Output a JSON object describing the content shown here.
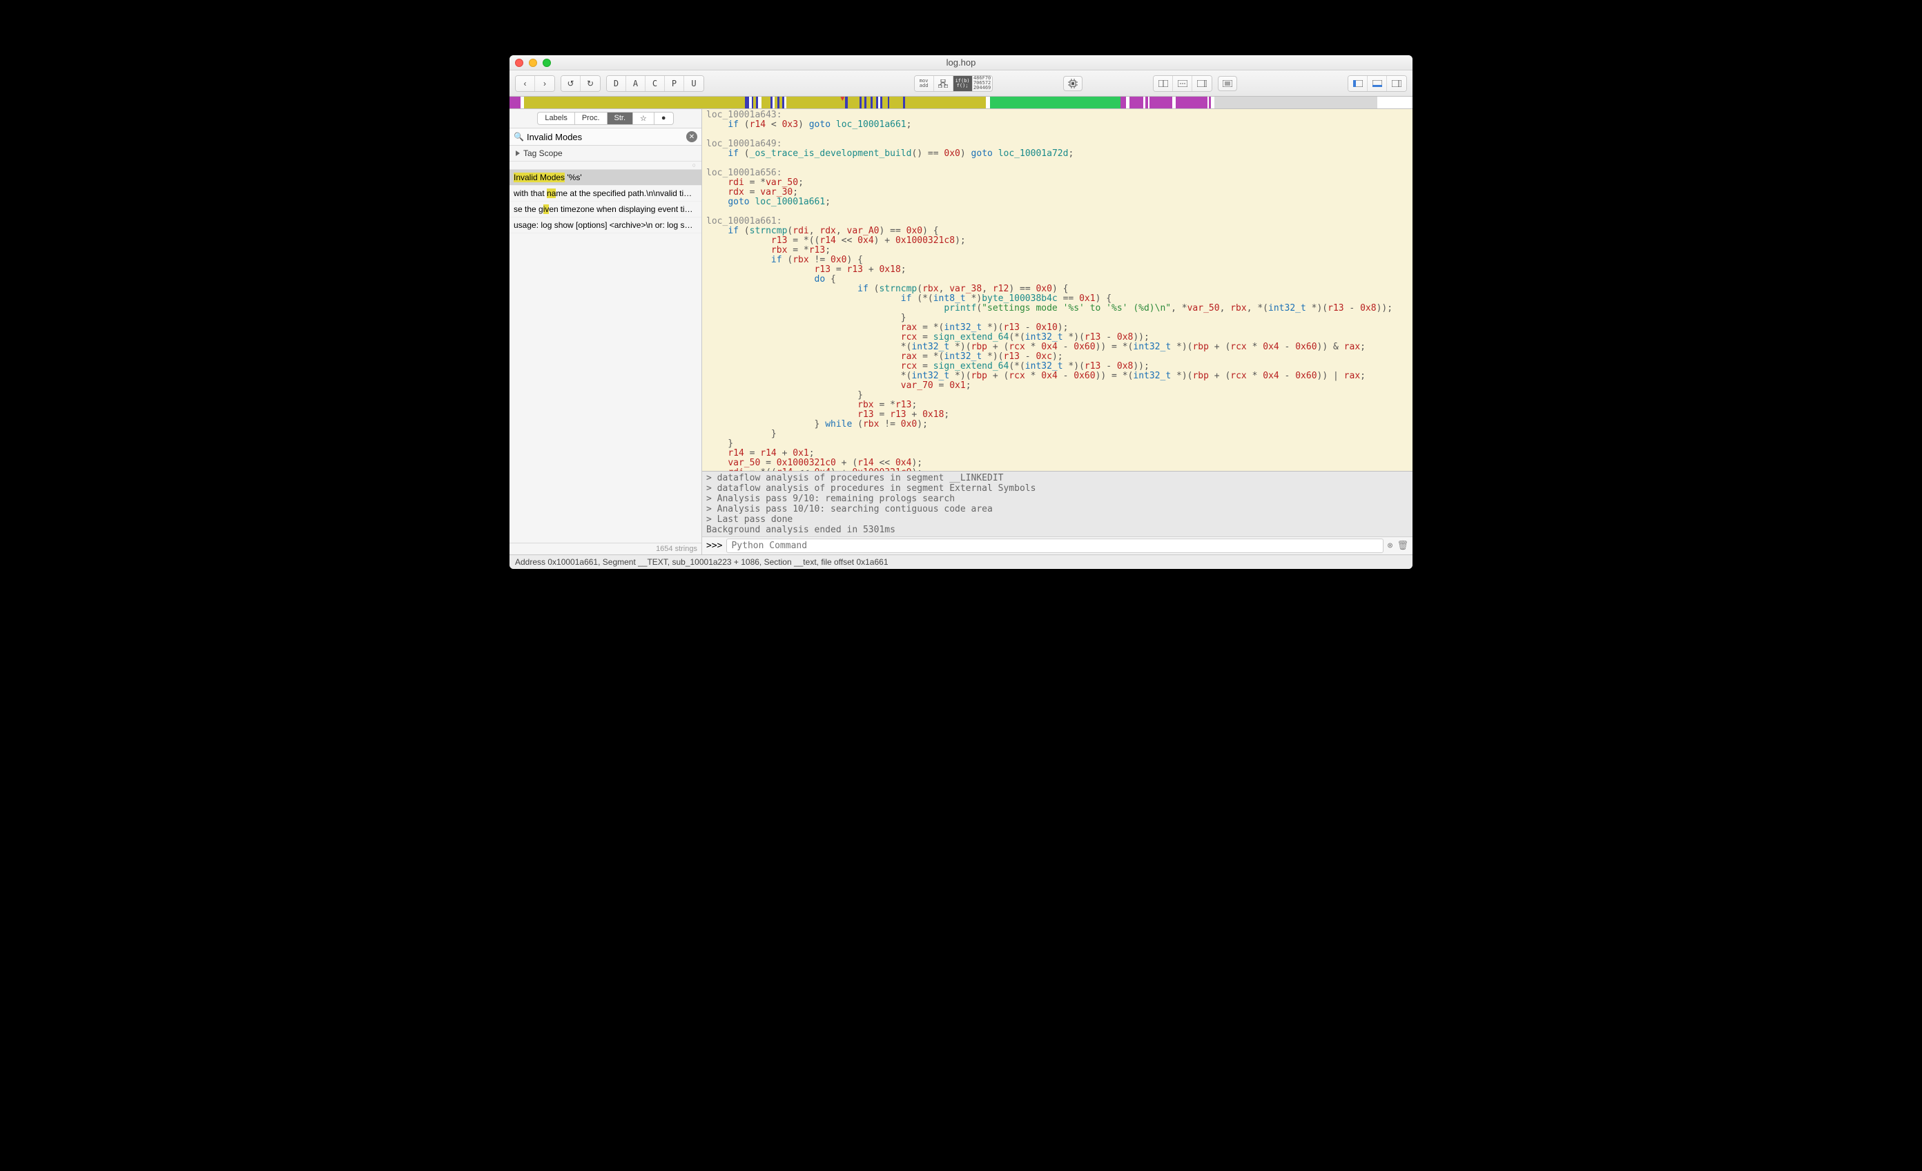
{
  "window": {
    "title": "log.hop"
  },
  "toolbar": {
    "nav_back": "‹",
    "nav_fwd": "›",
    "undo": "↺",
    "redo": "↻",
    "letters": [
      "D",
      "A",
      "C",
      "P",
      "U"
    ],
    "mode_mov": "mov",
    "mode_add": "add",
    "mode_if": "if(b)",
    "mode_f": "f();",
    "mode_num1": "486F70",
    "mode_num2": "706572",
    "mode_num3": "204469"
  },
  "nav": {
    "segments": [
      {
        "w": 1.2,
        "c": "#b541b5"
      },
      {
        "w": 0.4,
        "c": "#ffffff"
      },
      {
        "w": 24.5,
        "c": "#c9c12e"
      },
      {
        "w": 0.4,
        "c": "#3a3ab5"
      },
      {
        "w": 0.3,
        "c": "#ffffff"
      },
      {
        "w": 0.2,
        "c": "#3a3ab5"
      },
      {
        "w": 0.3,
        "c": "#c9c12e"
      },
      {
        "w": 0.2,
        "c": "#3a3ab5"
      },
      {
        "w": 0.4,
        "c": "#ffffff"
      },
      {
        "w": 1.0,
        "c": "#c9c12e"
      },
      {
        "w": 0.2,
        "c": "#3a3ab5"
      },
      {
        "w": 0.3,
        "c": "#ffffff"
      },
      {
        "w": 0.3,
        "c": "#c9c12e"
      },
      {
        "w": 0.2,
        "c": "#3a3ab5"
      },
      {
        "w": 0.3,
        "c": "#c9c12e"
      },
      {
        "w": 0.2,
        "c": "#3a3ab5"
      },
      {
        "w": 0.3,
        "c": "#ffffff"
      },
      {
        "w": 6.5,
        "c": "#c9c12e"
      },
      {
        "w": 0.3,
        "c": "#3a3ab5"
      },
      {
        "w": 1.3,
        "c": "#c9c12e"
      },
      {
        "w": 0.2,
        "c": "#3a3ab5"
      },
      {
        "w": 0.3,
        "c": "#c9c12e"
      },
      {
        "w": 0.2,
        "c": "#3a3ab5"
      },
      {
        "w": 0.5,
        "c": "#c9c12e"
      },
      {
        "w": 0.2,
        "c": "#3a3ab5"
      },
      {
        "w": 0.4,
        "c": "#c9c12e"
      },
      {
        "w": 0.2,
        "c": "#3a3ab5"
      },
      {
        "w": 0.3,
        "c": "#ffffff"
      },
      {
        "w": 0.2,
        "c": "#3a3ab5"
      },
      {
        "w": 0.6,
        "c": "#c9c12e"
      },
      {
        "w": 0.2,
        "c": "#3a3ab5"
      },
      {
        "w": 1.5,
        "c": "#c9c12e"
      },
      {
        "w": 0.2,
        "c": "#3a3ab5"
      },
      {
        "w": 9.0,
        "c": "#c9c12e"
      },
      {
        "w": 0.4,
        "c": "#ffffff"
      },
      {
        "w": 14.5,
        "c": "#2ec95c"
      },
      {
        "w": 0.6,
        "c": "#b541b5"
      },
      {
        "w": 0.4,
        "c": "#ffffff"
      },
      {
        "w": 1.5,
        "c": "#b541b5"
      },
      {
        "w": 0.2,
        "c": "#ffffff"
      },
      {
        "w": 0.3,
        "c": "#b541b5"
      },
      {
        "w": 0.2,
        "c": "#ffffff"
      },
      {
        "w": 2.5,
        "c": "#b541b5"
      },
      {
        "w": 0.4,
        "c": "#ffffff"
      },
      {
        "w": 3.5,
        "c": "#b541b5"
      },
      {
        "w": 0.2,
        "c": "#ffffff"
      },
      {
        "w": 0.2,
        "c": "#b541b5"
      },
      {
        "w": 0.4,
        "c": "#ffffff"
      },
      {
        "w": 18.0,
        "c": "#d8d8d8"
      }
    ],
    "marker_pos": 36.5
  },
  "sidebar": {
    "tabs": [
      "Labels",
      "Proc.",
      "Str.",
      "☆",
      "●"
    ],
    "active_tab": 2,
    "search_value": "Invalid Modes",
    "tag_scope": "Tag Scope",
    "results": [
      {
        "pre": "",
        "hl": "Invalid Modes",
        "post": " '%s'",
        "selected": true
      },
      {
        "pre": "with that ",
        "hl": "na",
        "post": "me at the specified path.\\n\\nvalid time f…"
      },
      {
        "pre": "se the g",
        "hl": "iv",
        "post": "en timezone when displaying event timest…"
      },
      {
        "pre": "usage: log show [options] <archive>\\n   or: log sho…",
        "hl": "",
        "post": ""
      }
    ],
    "status": "1654 strings"
  },
  "log": {
    "lines": [
      "> dataflow analysis of procedures in segment __LINKEDIT",
      "> dataflow analysis of procedures in segment External Symbols",
      "> Analysis pass 9/10: remaining prologs search",
      "> Analysis pass 10/10: searching contiguous code area",
      "> Last pass done",
      "Background analysis ended in 5301ms"
    ]
  },
  "prompt": {
    "prefix": ">>>",
    "placeholder": "Python Command"
  },
  "statusbar": "Address 0x10001a661, Segment __TEXT, sub_10001a223 + 1086, Section __text, file offset 0x1a661"
}
